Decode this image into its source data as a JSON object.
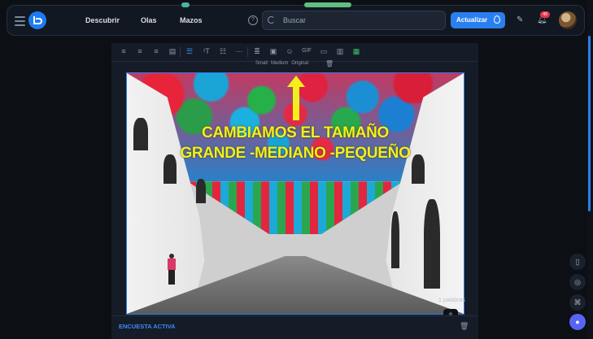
{
  "nav": {
    "links": [
      "Descubrir",
      "Olas",
      "Mazos"
    ],
    "search_placeholder": "Buscar",
    "update_label": "Actualizar",
    "notification_count": "49"
  },
  "editor": {
    "toolbar_icons": [
      "align-left-icon",
      "align-center-icon",
      "align-right-icon",
      "align-justify-icon",
      "text-align-icon",
      "font-size-icon",
      "list-icon",
      "more-icon",
      "paragraph-icon",
      "image-icon",
      "emoji-icon",
      "gif-icon",
      "video-icon",
      "chart-icon",
      "map-icon"
    ],
    "gif_label": "GIF",
    "size_options": [
      "Small",
      "Medium",
      "Original"
    ],
    "overlay_line1": "CAMBIAMOS EL TAMAÑO",
    "overlay_line2": "GRANDE -MEDIANO -PEQUEÑO",
    "word_count": "1 palabras",
    "survey_label": "ENCUESTA ACTIVA"
  },
  "colors": {
    "accent": "#2a7ff0",
    "overlay_text": "#f4ef1c",
    "badge": "#e5344b"
  }
}
